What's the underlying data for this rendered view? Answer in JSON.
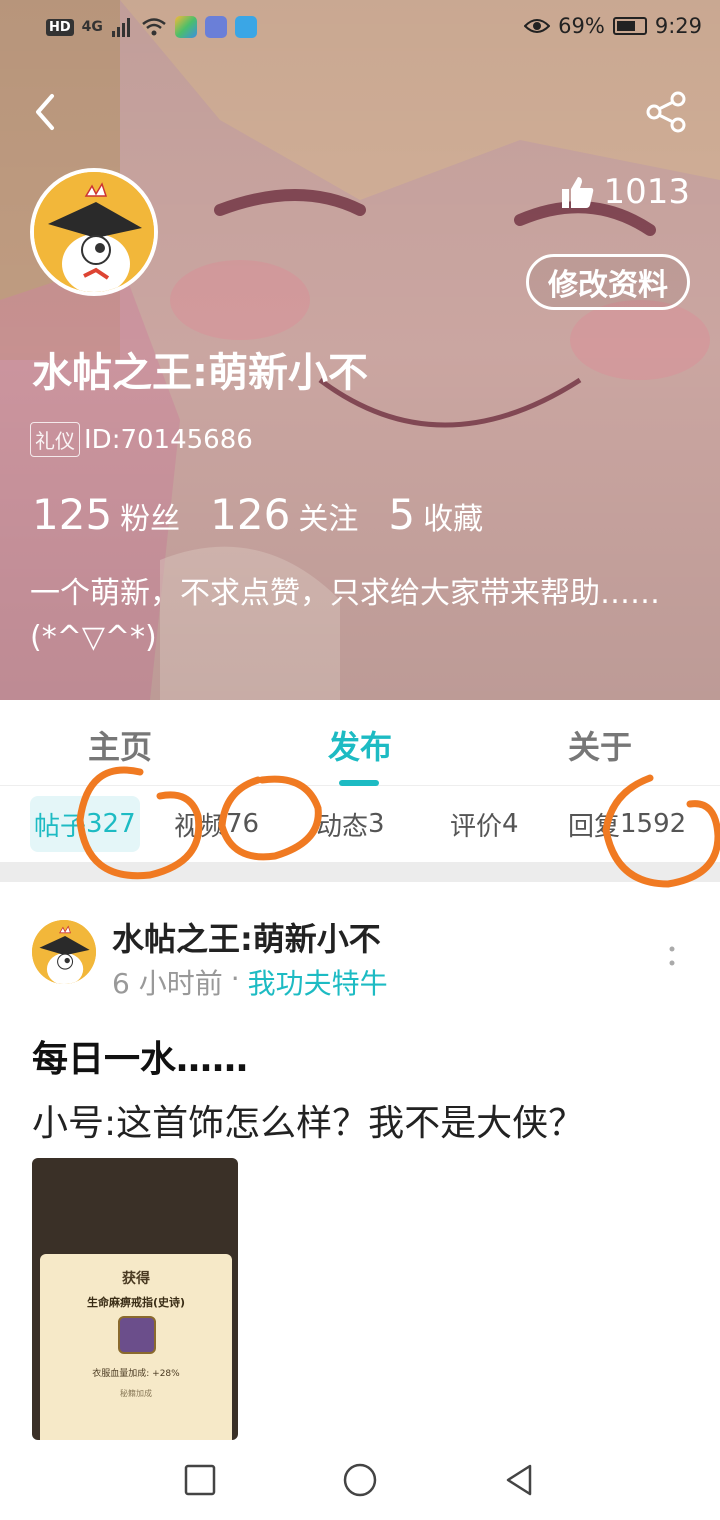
{
  "status_bar": {
    "hd_label": "HD",
    "net_label": "4G",
    "battery_text": "69%",
    "battery_level": 0.69,
    "time": "9:29"
  },
  "header": {
    "like_count": "1013",
    "edit_label": "修改资料",
    "nickname": "水帖之王:萌新小不",
    "id_tag": "礼仪",
    "id_text": "ID:70145686",
    "stats": [
      {
        "value": "125",
        "label": "粉丝"
      },
      {
        "value": "126",
        "label": "关注"
      },
      {
        "value": "5",
        "label": "收藏"
      }
    ],
    "bio": "一个萌新，不求点赞，只求给大家带来帮助…… (*^▽^*)"
  },
  "main_tabs": [
    {
      "label": "主页"
    },
    {
      "label": "发布"
    },
    {
      "label": "关于"
    }
  ],
  "sub_tabs": [
    {
      "label": "帖子",
      "count": "327"
    },
    {
      "label": "视频",
      "count": "76"
    },
    {
      "label": "动态",
      "count": "3"
    },
    {
      "label": "评价",
      "count": "4"
    },
    {
      "label": "回复",
      "count": "1592"
    }
  ],
  "post": {
    "author": "水帖之王:萌新小不",
    "time": "6 小时前",
    "separator": "·",
    "topic": "我功夫特牛",
    "title": "每日一水……",
    "body": "小号:这首饰怎么样？我不是大侠？",
    "image": {
      "panel_title": "获得",
      "item_name": "生命麻痹戒指(史诗)",
      "stat": "衣服血量加成: +28%",
      "sub": "秘籍加成"
    }
  },
  "colors": {
    "accent": "#1dbbc3",
    "annotation": "#f07a22"
  }
}
